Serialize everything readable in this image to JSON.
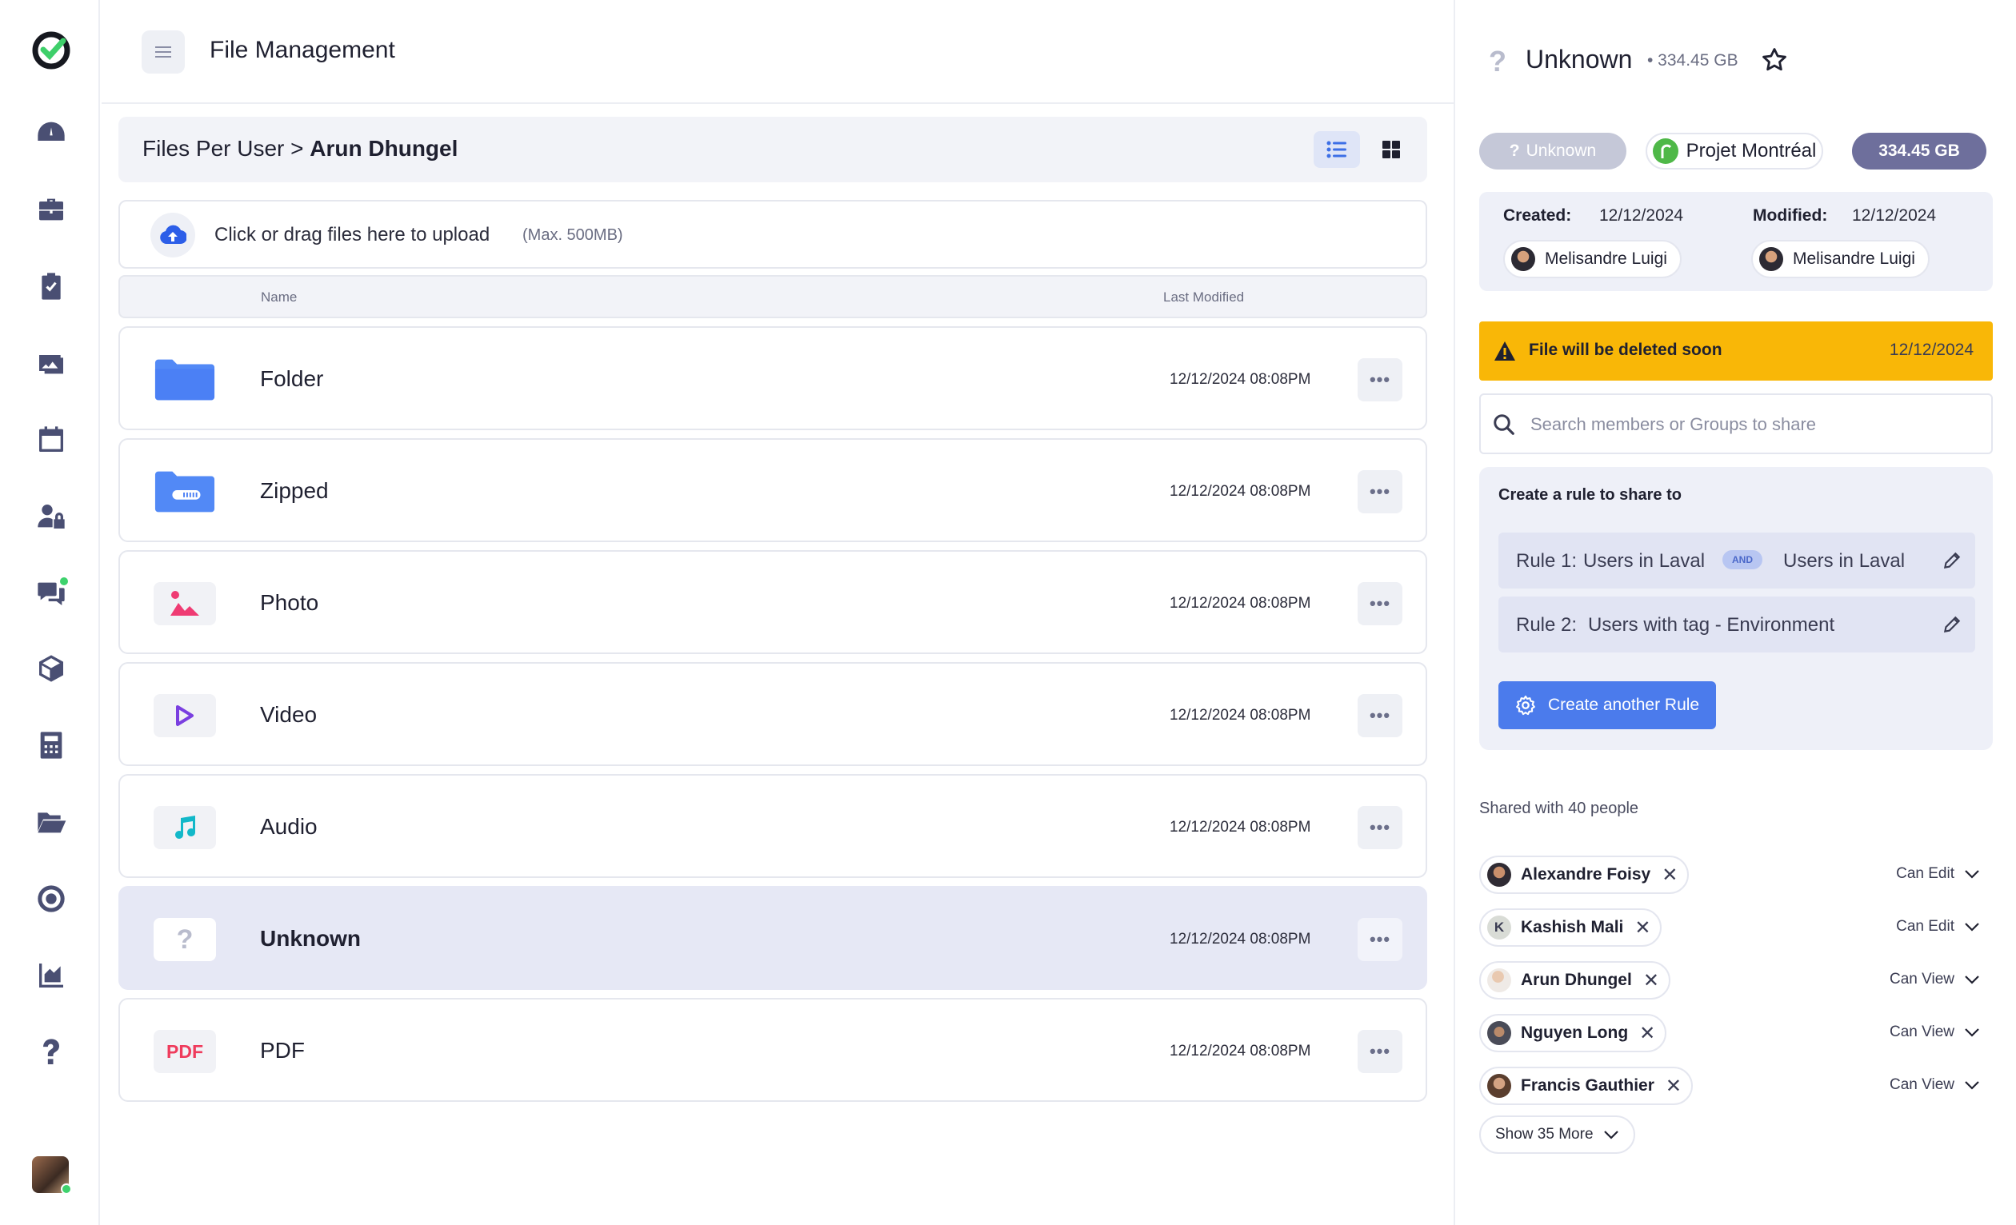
{
  "header": {
    "title": "File Management"
  },
  "breadcrumb": {
    "parent": "Files Per User >",
    "current": "Arun Dhungel"
  },
  "upload": {
    "text": "Click or drag files here to upload",
    "max": "(Max. 500MB)"
  },
  "table": {
    "col_name": "Name",
    "col_modified": "Last Modified",
    "rows": [
      {
        "name": "Folder",
        "date": "12/12/2024 08:08PM",
        "icon": "folder-icon"
      },
      {
        "name": "Zipped",
        "date": "12/12/2024 08:08PM",
        "icon": "zip-folder-icon"
      },
      {
        "name": "Photo",
        "date": "12/12/2024 08:08PM",
        "icon": "image-icon"
      },
      {
        "name": "Video",
        "date": "12/12/2024 08:08PM",
        "icon": "play-icon"
      },
      {
        "name": "Audio",
        "date": "12/12/2024 08:08PM",
        "icon": "music-note-icon"
      },
      {
        "name": "Unknown",
        "date": "12/12/2024 08:08PM",
        "icon": "question-icon",
        "selected": true
      },
      {
        "name": "PDF",
        "date": "12/12/2024 08:08PM",
        "icon": "pdf-icon",
        "icon_text": "PDF"
      }
    ]
  },
  "details": {
    "title": "Unknown",
    "size": "• 334.45 GB",
    "chip_type": "Unknown",
    "chip_project": "Projet Montréal",
    "chip_size": "334.45 GB",
    "created_label": "Created:",
    "created_date": "12/12/2024",
    "created_by": "Melisandre Luigi",
    "modified_label": "Modified:",
    "modified_date": "12/12/2024",
    "modified_by": "Melisandre Luigi",
    "warning_text": "File will be deleted soon",
    "warning_date": "12/12/2024",
    "search_placeholder": "Search members or Groups to share",
    "rule_heading": "Create a rule to share to",
    "rule1_label": "Rule 1:",
    "rule1_a": "Users in Laval",
    "rule1_op": "AND",
    "rule1_b": "Users in Laval",
    "rule2_label": "Rule 2:",
    "rule2_a": "Users with tag - Environment",
    "create_rule": "Create another Rule",
    "shared_with": "Shared with 40 people",
    "shared": [
      {
        "name": "Alexandre Foisy",
        "perm": "Can Edit",
        "initial": ""
      },
      {
        "name": "Kashish Mali",
        "perm": "Can Edit",
        "initial": "K"
      },
      {
        "name": "Arun Dhungel",
        "perm": "Can View",
        "initial": ""
      },
      {
        "name": "Nguyen Long",
        "perm": "Can View",
        "initial": ""
      },
      {
        "name": "Francis Gauthier",
        "perm": "Can View",
        "initial": ""
      }
    ],
    "show_more": "Show 35 More"
  },
  "colors": {
    "accent": "#4b7bec",
    "warning": "#f9b707",
    "selected_row": "#e6e8f5",
    "size_chip": "#6e6f9c"
  }
}
